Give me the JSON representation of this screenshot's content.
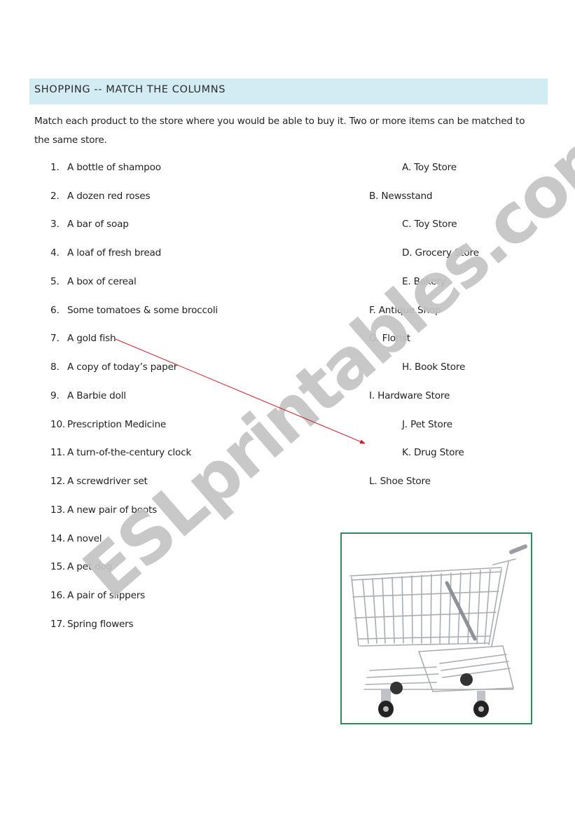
{
  "worksheet": {
    "title": "SHOPPING -- MATCH THE COLUMNS",
    "instructions": "Match each product to the store where you would be able to buy it. Two or more items can be matched to the same store.",
    "products": [
      {
        "number": "1.",
        "text": "A bottle of shampoo"
      },
      {
        "number": "2.",
        "text": "A dozen red roses"
      },
      {
        "number": "3.",
        "text": "A bar of soap"
      },
      {
        "number": "4.",
        "text": "A loaf of fresh bread"
      },
      {
        "number": "5.",
        "text": "A box of cereal"
      },
      {
        "number": "6.",
        "text": "Some tomatoes & some broccoli"
      },
      {
        "number": "7.",
        "text": "A gold fish"
      },
      {
        "number": "8.",
        "text": "A copy of today’s paper"
      },
      {
        "number": "9.",
        "text": "A Barbie doll"
      },
      {
        "number": "10.",
        "text": "Prescription Medicine"
      },
      {
        "number": "11.",
        "text": "A turn-of-the-century clock"
      },
      {
        "number": "12.",
        "text": "A screwdriver set"
      },
      {
        "number": "13.",
        "text": "A new pair of boots"
      },
      {
        "number": "14.",
        "text": "A novel"
      },
      {
        "number": "15.",
        "text": "A pet dog"
      },
      {
        "number": "16.",
        "text": "A pair of slippers"
      },
      {
        "number": "17.",
        "text": "Spring flowers"
      }
    ],
    "stores": [
      {
        "letter": "A.",
        "text": "Toy Store"
      },
      {
        "letter": "B.",
        "text": "Newsstand"
      },
      {
        "letter": "C.",
        "text": "Toy Store"
      },
      {
        "letter": "D.",
        "text": "Grocery Store"
      },
      {
        "letter": "E.",
        "text": "Bakery"
      },
      {
        "letter": "F.",
        "text": "Antique Shop"
      },
      {
        "letter": "G.",
        "text": "Florist"
      },
      {
        "letter": "H.",
        "text": "Book Store"
      },
      {
        "letter": "I.",
        "text": "Hardware Store"
      },
      {
        "letter": "J.",
        "text": "Pet Store"
      },
      {
        "letter": "K.",
        "text": "Drug Store"
      },
      {
        "letter": "L.",
        "text": "Shoe Store"
      }
    ],
    "answer_arrow": {
      "from_product": "7.",
      "to": "between J. and K.",
      "color": "#cc1f2a"
    },
    "image": {
      "subject": "shopping-cart",
      "frame_color": "#2e8b57"
    }
  },
  "watermark": "ESLprintables.com",
  "colors": {
    "header_bg": "#d3ebf3",
    "text": "#222222",
    "watermark": "#c4c4c4"
  }
}
